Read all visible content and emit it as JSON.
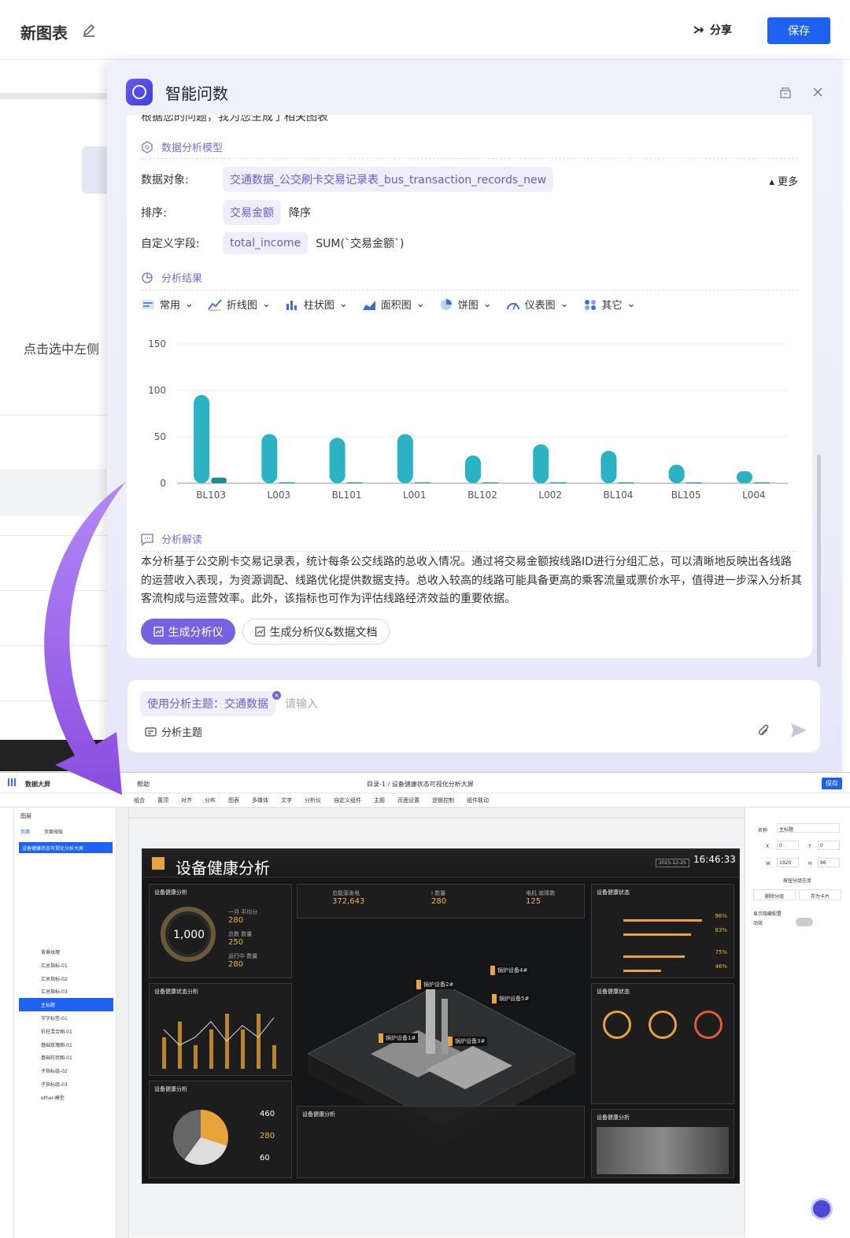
{
  "header": {
    "title": "新图表",
    "share_label": "分享",
    "save_label": "保存"
  },
  "background": {
    "hint": "点击选中左侧"
  },
  "panel": {
    "title": "智能问数",
    "truncated_line": "根据您的问题，我为您生成了相关图表",
    "model_section": "数据分析模型",
    "rows": {
      "object_label": "数据对象:",
      "object_value": "交通数据_公交刷卡交易记录表_bus_transaction_records_new",
      "sort_label": "排序:",
      "sort_value": "交易金额",
      "sort_order": "降序",
      "custom_label": "自定义字段:",
      "custom_value": "total_income",
      "custom_expr": "SUM(`交易金额`)"
    },
    "more_label": "更多",
    "result_section": "分析结果",
    "chart_tabs": [
      "常用",
      "折线图",
      "柱状图",
      "面积图",
      "饼图",
      "仪表图",
      "其它"
    ],
    "interp_section": "分析解读",
    "interp_text": "本分析基于公交刷卡交易记录表，统计每条公交线路的总收入情况。通过将交易金额按线路ID进行分组汇总，可以清晰地反映出各线路的运营收入表现，为资源调配、线路优化提供数据支持。总收入较高的线路可能具备更高的乘客流量或票价水平，值得进一步深入分析其客流构成与运营效率。此外，该指标也可作为评估线路经济效益的重要依据。",
    "gen_btn": "生成分析仪",
    "gen_doc_btn": "生成分析仪&数据文档"
  },
  "input": {
    "topic_chip": "使用分析主题：交通数据",
    "placeholder": "请输入",
    "topic_btn": "分析主题"
  },
  "chart_data": {
    "type": "bar",
    "categories": [
      "BL103",
      "L003",
      "BL101",
      "L001",
      "BL102",
      "L002",
      "BL104",
      "BL105",
      "L004"
    ],
    "series": [
      {
        "values": [
          95,
          53,
          49,
          53,
          30,
          42,
          35,
          20,
          13
        ]
      },
      {
        "values": [
          6,
          1,
          1,
          1,
          1,
          1,
          1,
          1,
          1
        ]
      }
    ],
    "yticks": [
      0,
      50,
      100,
      150
    ],
    "ylim": [
      0,
      150
    ],
    "colors": [
      "#2bb3c4",
      "#1f8a98"
    ]
  },
  "screenshot": {
    "app_name": "数据大屏",
    "breadcrumb": "目录-1 / 设备健康状态可视化分析大屏",
    "help": "帮助",
    "save": "保存",
    "layers_title": "图层",
    "tab_page": "页面",
    "tab_tpl": "页面母版",
    "selected_page": "设备健康状态可视化分析大屏",
    "layers": [
      "背景纹理",
      "汇总指标-01",
      "汇总指标-02",
      "汇总指标-03",
      "主标题",
      "字字标签-01",
      "折柱混合图-01",
      "基础玫瑰图-01",
      "基础柱状图-01",
      "子指标组-02",
      "子指标组-03",
      "other-模型"
    ],
    "toolbar": [
      "组合",
      "置顶",
      "对齐",
      "分布",
      "图表",
      "多媒体",
      "文字",
      "分析仪",
      "自定义组件",
      "主题",
      "页面设置",
      "逻辑控制",
      "组件联动"
    ],
    "props": {
      "name_label": "名称",
      "name_value": "主标题",
      "x_label": "X",
      "x": "0",
      "y_label": "Y",
      "y": "0",
      "w_label": "W",
      "w": "1920",
      "h_label": "H",
      "h": "96",
      "lock": "按钮分组在库",
      "btn1": "删除分组",
      "btn2": "存为卡片",
      "toggle": "显示隐藏配置",
      "anim": "动效"
    },
    "dashboard": {
      "title": "设备健康分析",
      "date": "2025-12-25",
      "clock": "16:46:33",
      "panel1": "设备健康分析",
      "gauge": "1,000",
      "kpis": [
        {
          "label": "一月 平均分",
          "value": "280"
        },
        {
          "label": "总数 数量",
          "value": "250"
        },
        {
          "label": "运行中 数量",
          "value": "280"
        }
      ],
      "top": [
        {
          "label": "总能源发电",
          "value": "372,643"
        },
        {
          "label": "I 数量",
          "value": "280"
        },
        {
          "label": "电机 故障数",
          "value": "125"
        }
      ],
      "panel2": "设备健康状态分析",
      "panel3": "设备健康分析",
      "donut_values": [
        "460",
        "280",
        "60"
      ],
      "right1": "设备健康状态",
      "right2": "设备健康状态",
      "right3": "设备健康分析",
      "center_bottom": "设备健康分析",
      "tags": [
        "锅炉设备1#",
        "锅炉设备2#",
        "锅炉设备3#",
        "锅炉设备4#",
        "锅炉设备5#"
      ],
      "percents": [
        "96%",
        "83%",
        "75%",
        "46%"
      ]
    }
  }
}
